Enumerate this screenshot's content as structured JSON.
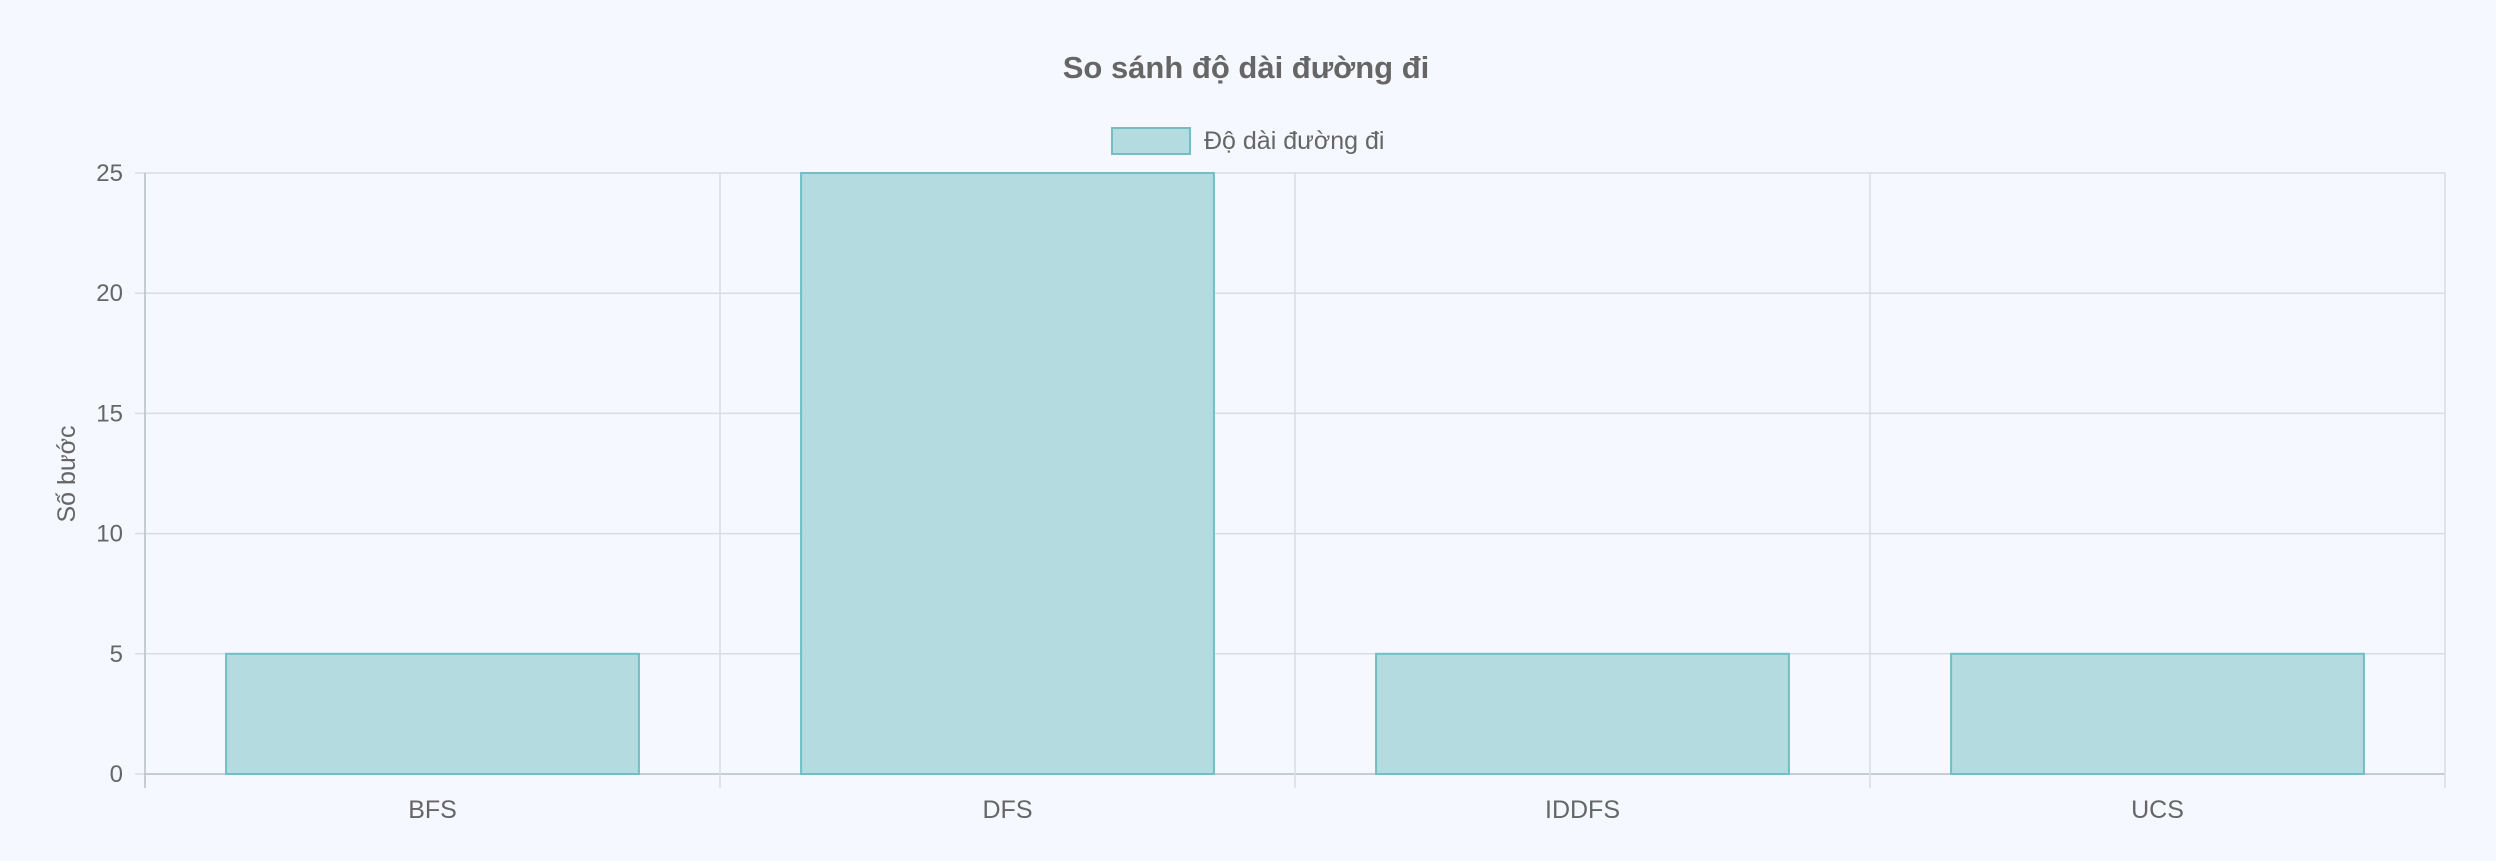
{
  "chart_data": {
    "type": "bar",
    "title": "So sánh độ dài đường đi",
    "xlabel": "",
    "ylabel": "Số bước",
    "categories": [
      "BFS",
      "DFS",
      "IDDFS",
      "UCS"
    ],
    "series": [
      {
        "name": "Độ dài đường đi",
        "values": [
          5,
          25,
          5,
          5
        ]
      }
    ],
    "ylim": [
      0,
      25
    ],
    "yticks": [
      "0",
      "5",
      "10",
      "15",
      "20",
      "25"
    ],
    "grid": true,
    "legend": "top-center",
    "colors": {
      "bar_fill": "#b3dbe0",
      "bar_stroke": "#6fbfc4",
      "grid": "#d9dde3",
      "axis": "#b8bec6",
      "text": "#666666",
      "title": "#666666"
    }
  }
}
